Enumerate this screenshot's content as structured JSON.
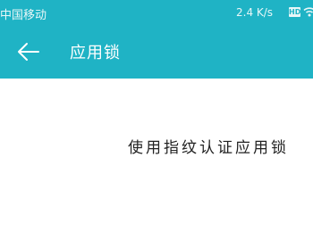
{
  "theme": {
    "accent": "#1fb3c5"
  },
  "status_bar": {
    "carrier": "中国移动",
    "net_speed": "2.4 K/s",
    "hd_badge": "HD",
    "wifi_icon": "wifi-icon"
  },
  "app_bar": {
    "back_icon": "arrow-left-icon",
    "title": "应用锁"
  },
  "content": {
    "hint": "使用指纹认证应用锁"
  }
}
